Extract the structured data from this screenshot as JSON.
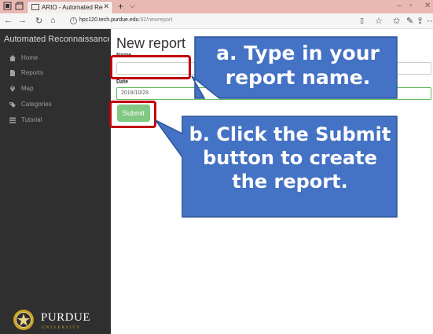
{
  "browser": {
    "tab_title": "ARIO - Automated Recc",
    "url_host": "hpc120.tech.purdue.edu",
    "url_path": ":82/newreport"
  },
  "sidebar": {
    "title": "Automated Reconnaissance Im...",
    "items": [
      {
        "label": "Home",
        "icon": "home-icon"
      },
      {
        "label": "Reports",
        "icon": "document-icon"
      },
      {
        "label": "Map",
        "icon": "map-pin-icon"
      },
      {
        "label": "Categories",
        "icon": "tag-icon"
      },
      {
        "label": "Tutorial",
        "icon": "list-icon"
      }
    ],
    "logo_text": "PURDUE",
    "logo_sub": "UNIVERSITY"
  },
  "main": {
    "heading": "New report",
    "name_label": "Name",
    "name_value": "",
    "date_label": "Date",
    "date_value": "2019/10/29",
    "submit_label": "Submit"
  },
  "annotations": {
    "callout_a_line1": "a. Type in your",
    "callout_a_line2": "report name.",
    "callout_b_line1": "b. Click the Submit",
    "callout_b_line2": "button to create",
    "callout_b_line3": "the report.",
    "callout_color": "#4472c4",
    "highlight_color": "#c0000c"
  }
}
